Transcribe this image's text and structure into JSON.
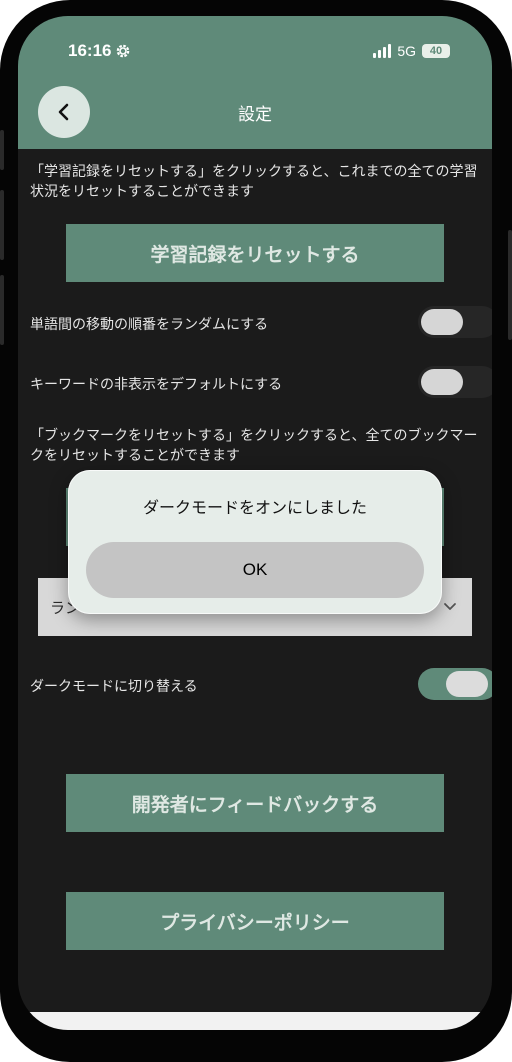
{
  "status_bar": {
    "time": "16:16",
    "network": "5G",
    "battery": "40"
  },
  "header": {
    "title": "設定",
    "back_icon": "chevron-left-icon"
  },
  "reset_history": {
    "description": "「学習記録をリセットする」をクリックすると、これまでの全ての学習状況をリセットすることができます",
    "button_label": "学習記録をリセットする"
  },
  "toggles": {
    "random_order": {
      "label": "単語間の移動の順番をランダムにする",
      "on": false
    },
    "hide_keywords": {
      "label": "キーワードの非表示をデフォルトにする",
      "on": false
    },
    "dark_mode": {
      "label": "ダークモードに切り替える",
      "on": true
    }
  },
  "reset_bookmarks": {
    "description": "「ブックマークをリセットする」をクリックすると、全てのブックマークをリセットすることができます"
  },
  "select": {
    "value": "ラン"
  },
  "feedback_button": "開発者にフィードバックする",
  "privacy_button": "プライバシーポリシー",
  "dialog": {
    "message": "ダークモードをオンにしました",
    "ok_label": "OK"
  },
  "colors": {
    "accent": "#5f8a79",
    "background": "#1b1b1b",
    "dialog": "#e6ede9"
  }
}
